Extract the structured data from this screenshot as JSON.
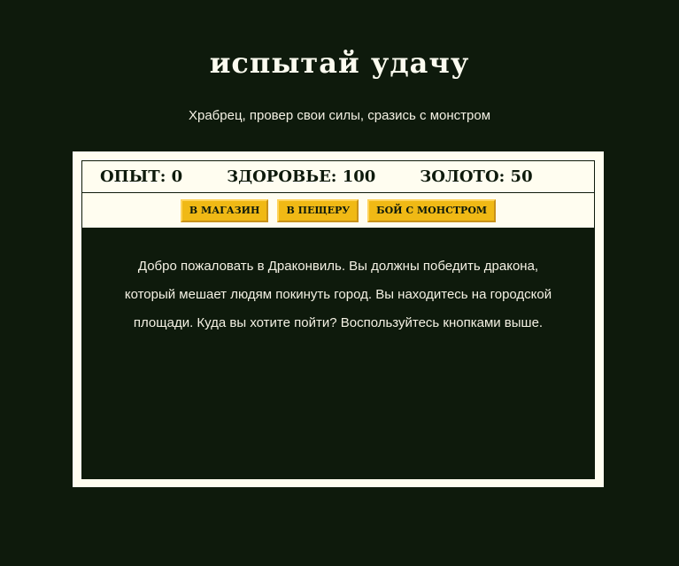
{
  "header": {
    "title": "испытай удачу",
    "subtitle": "Храбрец, провер свои силы, сразись с монстром"
  },
  "stats": {
    "xp_label": "ОПЫТ: 0",
    "health_label": "ЗДОРОВЬЕ: 100",
    "gold_label": "ЗОЛОТО: 50"
  },
  "controls": {
    "store_button": "В МАГАЗИН",
    "cave_button": "В ПЕЩЕРУ",
    "fight_button": "БОЙ С МОНСТРОМ"
  },
  "message": {
    "text": "Добро пожаловать в Драконвиль. Вы должны победить дракона, который мешает людям покинуть город. Вы находитесь на городской площади. Куда вы хотите пойти? Воспользуйтесь кнопками выше."
  },
  "colors": {
    "background": "#0e1a0c",
    "panel": "#fffdf0",
    "button": "#f0b915",
    "text_light": "#f4f1e4"
  }
}
